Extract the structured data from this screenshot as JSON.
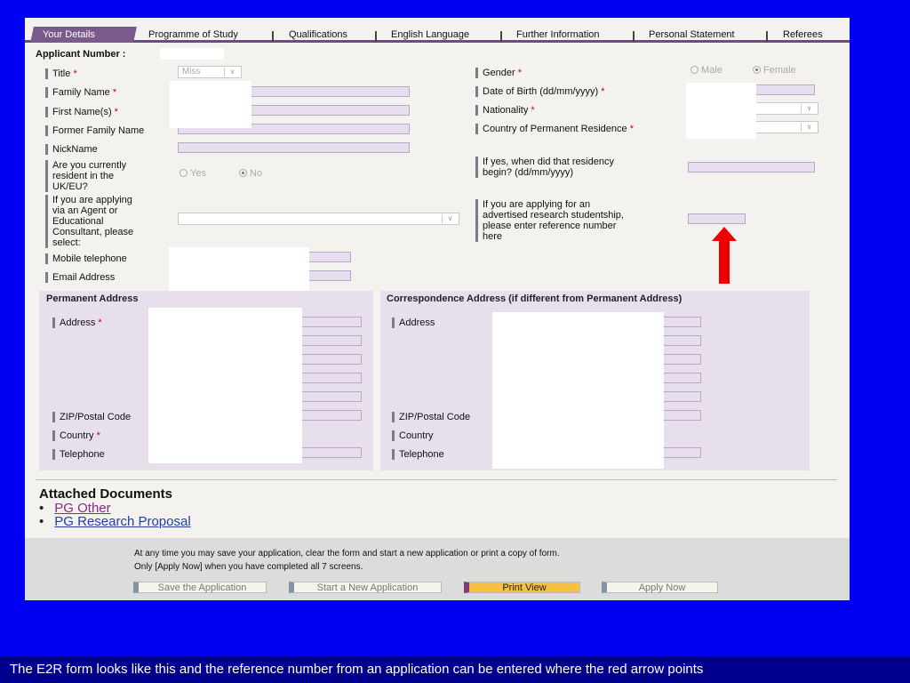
{
  "tabs": [
    "Your Details",
    "Programme of Study",
    "Qualifications",
    "English Language",
    "Further Information",
    "Personal Statement",
    "Referees"
  ],
  "applicant_number_label": "Applicant Number :",
  "left_fields": {
    "title": "Title",
    "title_value": "Miss",
    "family_name": "Family Name",
    "first_names": "First Name(s)",
    "former_family_name": "Former Family Name",
    "nickname": "NickName",
    "resident_line1": "Are you currently",
    "resident_line2": "resident in the",
    "resident_line3": "UK/EU?",
    "resident_yes": "Yes",
    "resident_no": "No",
    "agent_line1": "If you are applying",
    "agent_line2": "via an Agent or",
    "agent_line3": "Educational",
    "agent_line4": "Consultant, please",
    "agent_line5": "select:",
    "mobile": "Mobile telephone",
    "email": "Email Address"
  },
  "right_fields": {
    "gender": "Gender",
    "gender_male": "Male",
    "gender_female": "Female",
    "dob": "Date of Birth (dd/mm/yyyy)",
    "nationality": "Nationality",
    "country_residence": "Country of Permanent Residence",
    "residency_line1": "If yes, when did that residency",
    "residency_line2": "begin? (dd/mm/yyyy)",
    "studentship_line1": "If you are applying for an",
    "studentship_line2": "advertised research studentship,",
    "studentship_line3": "please enter reference number",
    "studentship_line4": "here"
  },
  "required_marker": "*",
  "permanent_address": {
    "title": "Permanent Address",
    "address": "Address",
    "zip": "ZIP/Postal Code",
    "country": "Country",
    "telephone": "Telephone"
  },
  "correspondence_address": {
    "title": "Correspondence Address (if different from Permanent Address)",
    "address": "Address",
    "zip": "ZIP/Postal Code",
    "country": "Country",
    "telephone": "Telephone"
  },
  "attached_documents": {
    "title": "Attached Documents",
    "items": [
      "PG Other",
      "PG Research Proposal"
    ]
  },
  "footer": {
    "line1": "At any time you may save your application, clear the form and start a new application or print a copy of form.",
    "line2": "Only [Apply Now] when you have completed all 7 screens.",
    "buttons": [
      "Save the Application",
      "Start a New Application",
      "Print View",
      "Apply Now"
    ]
  },
  "caption": "The E2R form looks like this and the reference number from an application can be entered where the red arrow points",
  "colors": {
    "slide_background": "#0000f5",
    "caption_bar": "#00008c",
    "active_tab": "#7a5a8c",
    "input_fill": "#e7ddef",
    "required": "#cc0000",
    "arrow": "#ee0000",
    "print_button": "#f6c143"
  }
}
